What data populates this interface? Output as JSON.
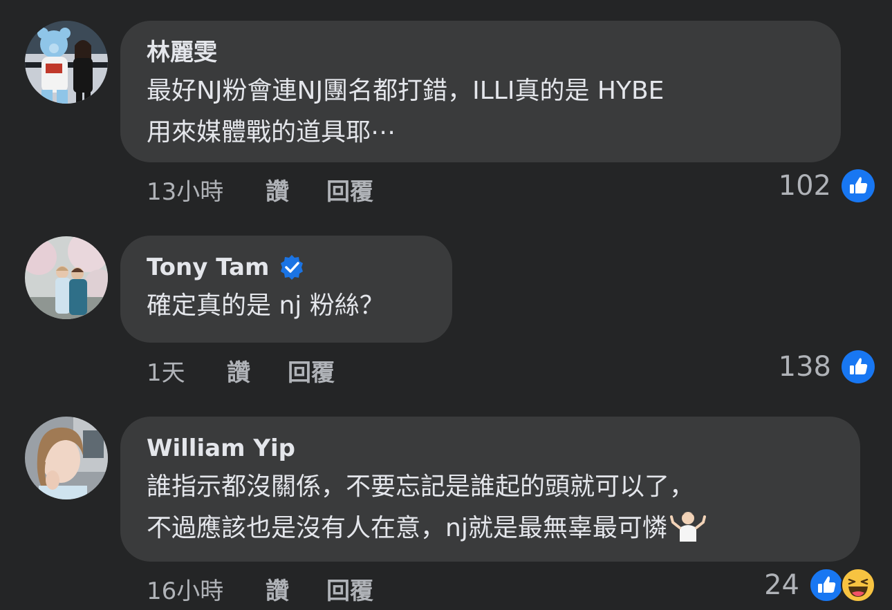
{
  "comments": [
    {
      "author": "林麗雯",
      "verified": false,
      "lines": [
        "最好NJ粉會連NJ團名都打錯，ILLI真的是 HYBE",
        "用來媒體戰的道具耶⋯"
      ],
      "time": "13小時",
      "like_label": "讚",
      "reply_label": "回覆",
      "reaction_count": "102",
      "reactions": [
        "like-icon"
      ]
    },
    {
      "author": "Tony Tam",
      "verified": true,
      "lines": [
        "確定真的是 nj 粉絲？"
      ],
      "time": "1天",
      "like_label": "讚",
      "reply_label": "回覆",
      "reaction_count": "138",
      "reactions": [
        "like-icon"
      ]
    },
    {
      "author": "William Yip",
      "verified": false,
      "lines": [
        "誰指示都沒關係，不要忘記是誰起的頭就可以了，",
        "不過應該也是沒有人在意，nj就是最無辜最可憐"
      ],
      "trailing_emoji": "person-shrugging-emoji",
      "time": "16小時",
      "like_label": "讚",
      "reply_label": "回覆",
      "reaction_count": "24",
      "reactions": [
        "like-icon",
        "haha-icon"
      ]
    }
  ],
  "colors": {
    "background": "#242526",
    "bubble": "#3a3b3c",
    "primary_text": "#e4e6eb",
    "secondary_text": "#b0b3b8",
    "like_blue": "#1877f2",
    "verified_blue": "#1b74e4"
  }
}
